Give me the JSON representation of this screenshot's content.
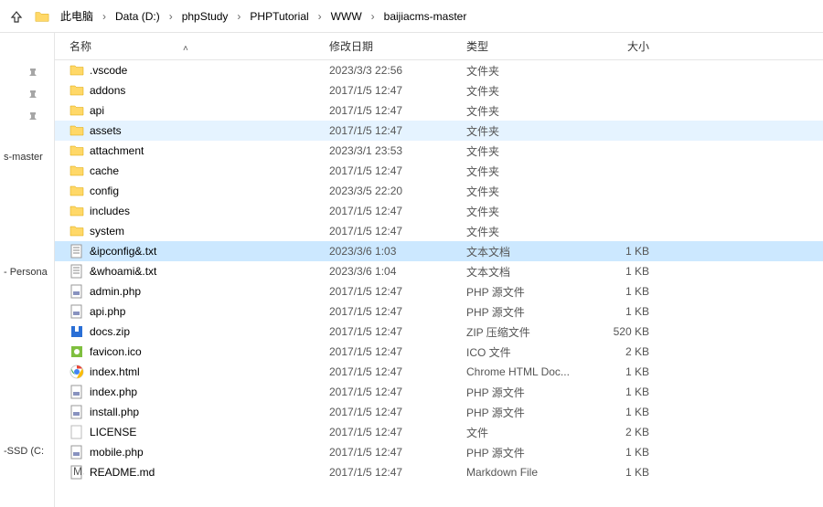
{
  "breadcrumb": [
    {
      "label": "此电脑"
    },
    {
      "label": "Data (D:)"
    },
    {
      "label": "phpStudy"
    },
    {
      "label": "PHPTutorial"
    },
    {
      "label": "WWW"
    },
    {
      "label": "baijiacms-master"
    }
  ],
  "columns": {
    "name": "名称",
    "date": "修改日期",
    "type": "类型",
    "size": "大小"
  },
  "sidebar": {
    "item1": "s-master",
    "item2": "- Persona",
    "item3": "-SSD (C:"
  },
  "files": [
    {
      "icon": "folder",
      "name": ".vscode",
      "date": "2023/3/3 22:56",
      "type": "文件夹",
      "size": "",
      "state": ""
    },
    {
      "icon": "folder",
      "name": "addons",
      "date": "2017/1/5 12:47",
      "type": "文件夹",
      "size": "",
      "state": ""
    },
    {
      "icon": "folder",
      "name": "api",
      "date": "2017/1/5 12:47",
      "type": "文件夹",
      "size": "",
      "state": ""
    },
    {
      "icon": "folder",
      "name": "assets",
      "date": "2017/1/5 12:47",
      "type": "文件夹",
      "size": "",
      "state": "hover"
    },
    {
      "icon": "folder",
      "name": "attachment",
      "date": "2023/3/1 23:53",
      "type": "文件夹",
      "size": "",
      "state": ""
    },
    {
      "icon": "folder",
      "name": "cache",
      "date": "2017/1/5 12:47",
      "type": "文件夹",
      "size": "",
      "state": ""
    },
    {
      "icon": "folder",
      "name": "config",
      "date": "2023/3/5 22:20",
      "type": "文件夹",
      "size": "",
      "state": ""
    },
    {
      "icon": "folder",
      "name": "includes",
      "date": "2017/1/5 12:47",
      "type": "文件夹",
      "size": "",
      "state": ""
    },
    {
      "icon": "folder",
      "name": "system",
      "date": "2017/1/5 12:47",
      "type": "文件夹",
      "size": "",
      "state": ""
    },
    {
      "icon": "txt",
      "name": "&ipconfig&.txt",
      "date": "2023/3/6 1:03",
      "type": "文本文档",
      "size": "1 KB",
      "state": "selected"
    },
    {
      "icon": "txt",
      "name": "&whoami&.txt",
      "date": "2023/3/6 1:04",
      "type": "文本文档",
      "size": "1 KB",
      "state": ""
    },
    {
      "icon": "php",
      "name": "admin.php",
      "date": "2017/1/5 12:47",
      "type": "PHP 源文件",
      "size": "1 KB",
      "state": ""
    },
    {
      "icon": "php",
      "name": "api.php",
      "date": "2017/1/5 12:47",
      "type": "PHP 源文件",
      "size": "1 KB",
      "state": ""
    },
    {
      "icon": "zip",
      "name": "docs.zip",
      "date": "2017/1/5 12:47",
      "type": "ZIP 压缩文件",
      "size": "520 KB",
      "state": ""
    },
    {
      "icon": "ico",
      "name": "favicon.ico",
      "date": "2017/1/5 12:47",
      "type": "ICO 文件",
      "size": "2 KB",
      "state": ""
    },
    {
      "icon": "chrome",
      "name": "index.html",
      "date": "2017/1/5 12:47",
      "type": "Chrome HTML Doc...",
      "size": "1 KB",
      "state": ""
    },
    {
      "icon": "php",
      "name": "index.php",
      "date": "2017/1/5 12:47",
      "type": "PHP 源文件",
      "size": "1 KB",
      "state": ""
    },
    {
      "icon": "php",
      "name": "install.php",
      "date": "2017/1/5 12:47",
      "type": "PHP 源文件",
      "size": "1 KB",
      "state": ""
    },
    {
      "icon": "file",
      "name": "LICENSE",
      "date": "2017/1/5 12:47",
      "type": "文件",
      "size": "2 KB",
      "state": ""
    },
    {
      "icon": "php",
      "name": "mobile.php",
      "date": "2017/1/5 12:47",
      "type": "PHP 源文件",
      "size": "1 KB",
      "state": ""
    },
    {
      "icon": "md",
      "name": "README.md",
      "date": "2017/1/5 12:47",
      "type": "Markdown File",
      "size": "1 KB",
      "state": ""
    }
  ]
}
